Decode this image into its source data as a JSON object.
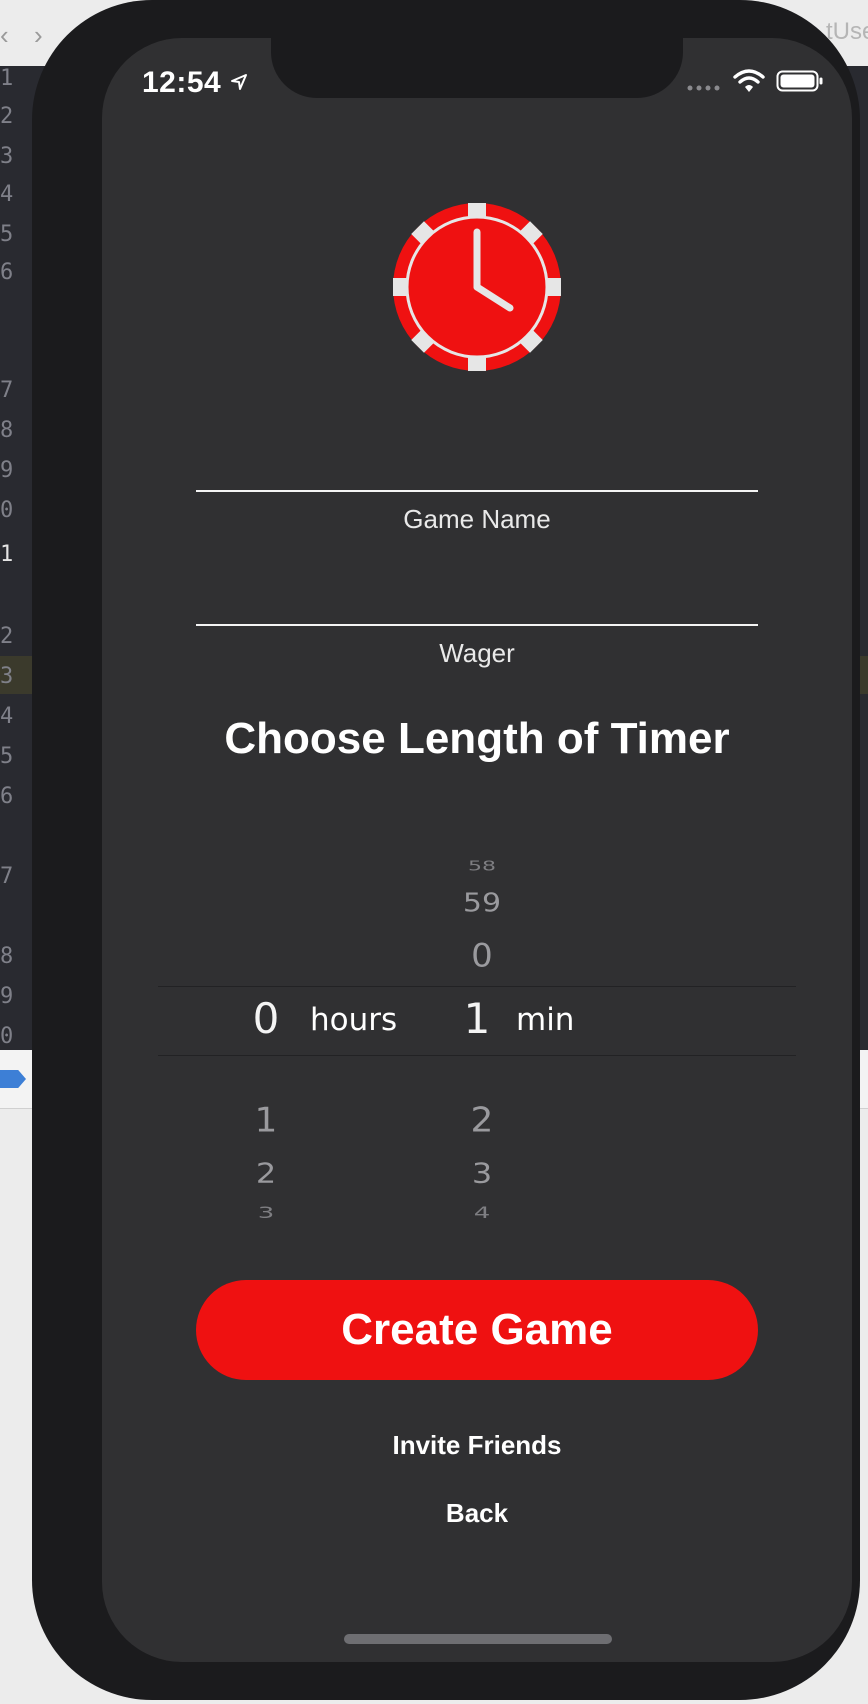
{
  "background_editor": {
    "line_numbers": [
      "1",
      "2",
      "3",
      "4",
      "5",
      "6",
      "7",
      "8",
      "9",
      "0",
      "1",
      "2",
      "3",
      "4",
      "5",
      "6",
      "7",
      "8",
      "9",
      "0"
    ],
    "title_fragment": "tUse"
  },
  "status_bar": {
    "time": "12:54",
    "icons": [
      "location-arrow-icon",
      "signal-dots-icon",
      "wifi-icon",
      "battery-icon"
    ]
  },
  "logo": {
    "icon": "clock-chip-icon",
    "color": "#ef1111"
  },
  "form": {
    "game_name": {
      "label": "Game Name",
      "value": ""
    },
    "wager": {
      "label": "Wager",
      "value": ""
    }
  },
  "timer": {
    "title": "Choose Length of Timer",
    "hours": {
      "unit": "hours",
      "selected": "0",
      "below": [
        "1",
        "2",
        "3"
      ]
    },
    "minutes": {
      "unit": "min",
      "selected": "1",
      "above": [
        "58",
        "59",
        "0"
      ],
      "below": [
        "2",
        "3",
        "4"
      ]
    }
  },
  "actions": {
    "create": "Create Game",
    "invite": "Invite Friends",
    "back": "Back"
  },
  "colors": {
    "accent": "#ef1111",
    "screen_bg": "#303032",
    "text": "#ffffff"
  }
}
